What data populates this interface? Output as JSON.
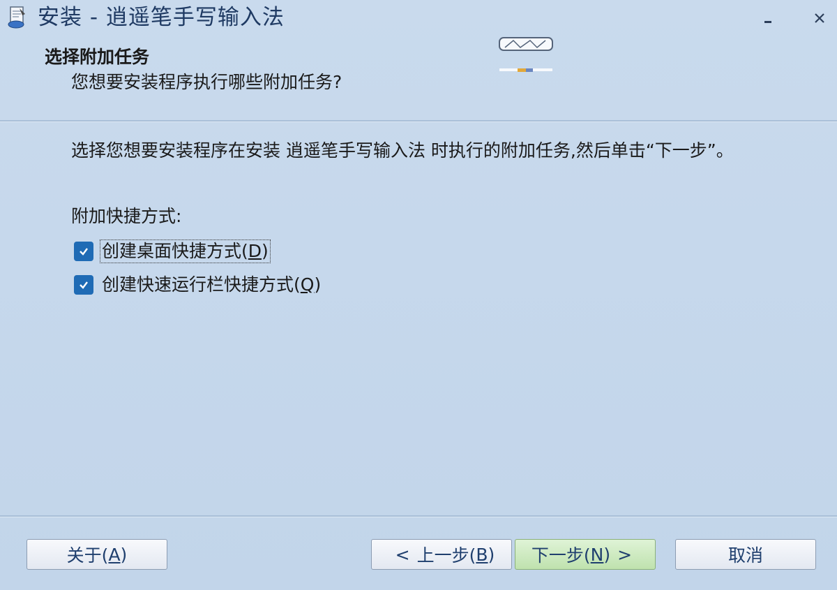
{
  "window": {
    "title": "安装 - 逍遥笔手写输入法",
    "minimize_symbol": "–",
    "close_symbol": "×"
  },
  "header": {
    "title": "选择附加任务",
    "subtitle": "您想要安装程序执行哪些附加任务?"
  },
  "content": {
    "intro": "选择您想要安装程序在安装 逍遥笔手写输入法 时执行的附加任务,然后单击“下一步”。",
    "group_label": "附加快捷方式:",
    "options": [
      {
        "label": "创建桌面快捷方式(",
        "hotkey": "D",
        "suffix": ")",
        "checked": true
      },
      {
        "label": "创建快速运行栏快捷方式(",
        "hotkey": "Q",
        "suffix": ")",
        "checked": true
      }
    ]
  },
  "buttons": {
    "about": {
      "label": "关于(",
      "hotkey": "A",
      "suffix": ")"
    },
    "back": {
      "arrow": "<",
      "label": "上一步(",
      "hotkey": "B",
      "suffix": ")"
    },
    "next": {
      "label": "下一步(",
      "hotkey": "N",
      "suffix": ")",
      "arrow": ">"
    },
    "cancel": {
      "label": "取消"
    }
  },
  "colors": {
    "background": "#c3d5ea",
    "title_text": "#1f3a63",
    "checkbox": "#1f6bb5",
    "next_button": "#bfe2ae"
  },
  "icons": {
    "app": "installer-icon",
    "checkbox_check": "check-icon",
    "header_logo": "pen-logo-icon"
  }
}
